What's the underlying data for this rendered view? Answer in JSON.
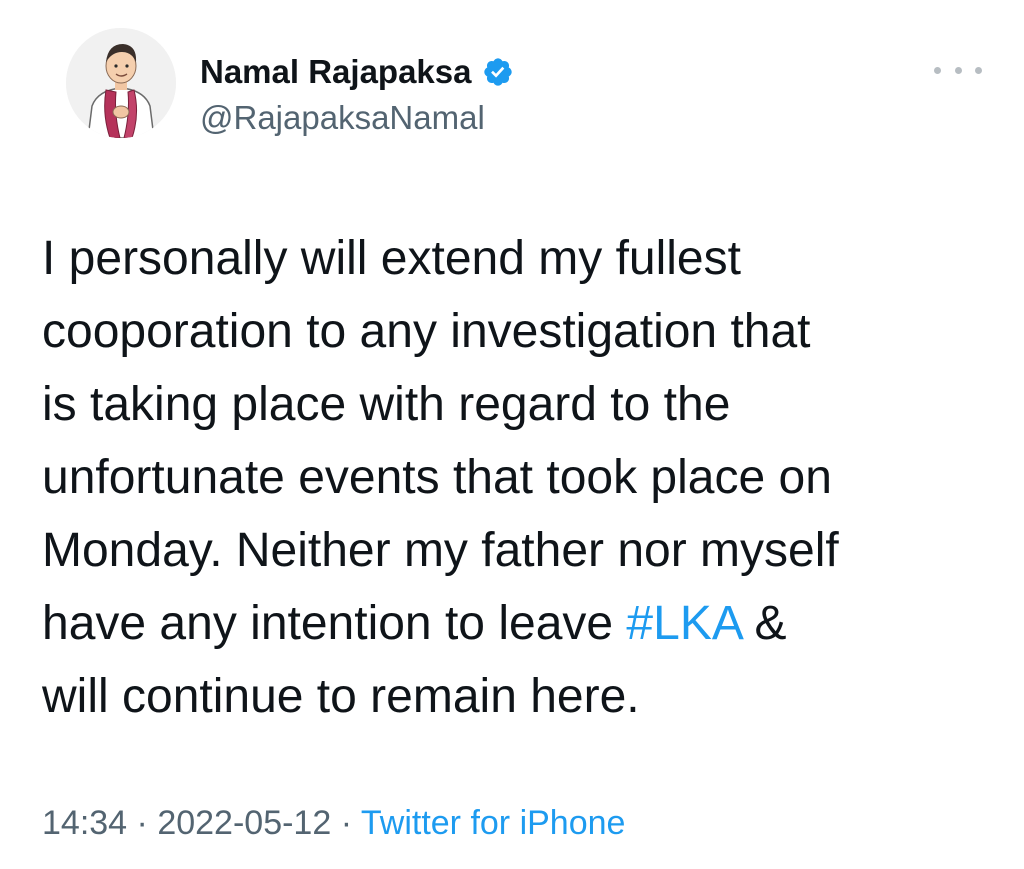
{
  "author": {
    "display_name": "Namal Rajapaksa",
    "handle": "@RajapaksaNamal",
    "verified_icon": "verified-badge-icon",
    "avatar_icon": "illustrated-avatar"
  },
  "tweet": {
    "lines": [
      "I personally will extend my fullest",
      "cooporation to any investigation that",
      "is taking place with regard to the",
      "unfortunate events that took place on",
      "Monday. Neither my father nor myself"
    ],
    "line6_before": "have any intention to leave ",
    "hashtag": "#LKA",
    "line6_after": " &",
    "line7": "will continue to remain here."
  },
  "meta": {
    "time": "14:34",
    "separator": "·",
    "date": "2022-05-12",
    "source": "Twitter for iPhone"
  },
  "colors": {
    "link": "#1d9bf0",
    "secondary_text": "#536471",
    "primary_text": "#0f1419"
  }
}
